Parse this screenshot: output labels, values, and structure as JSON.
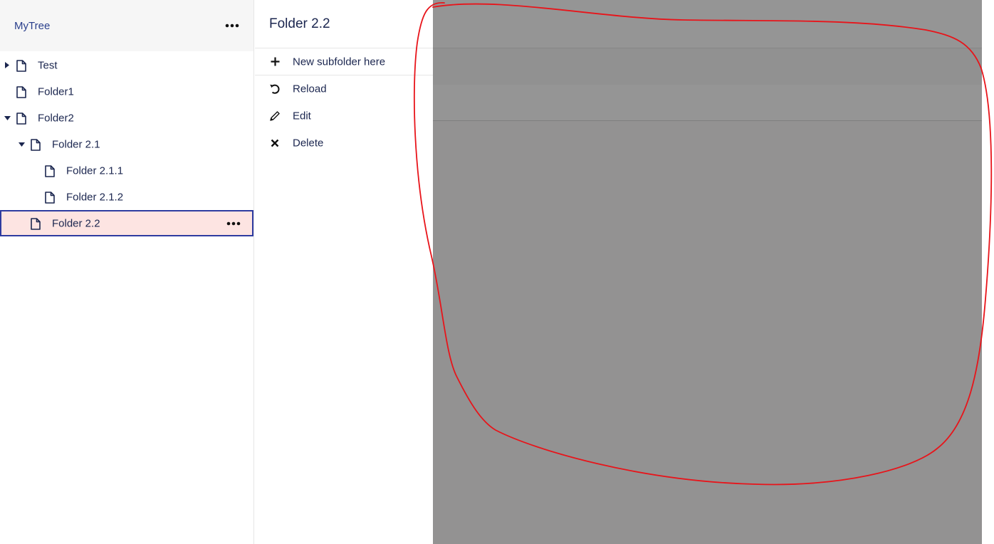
{
  "sidebar": {
    "title": "MyTree",
    "menu_icon": "more-horizontal-icon",
    "items": [
      {
        "label": "Test",
        "depth": 0,
        "caret": "right",
        "icon": "file-icon"
      },
      {
        "label": "Folder1",
        "depth": 0,
        "caret": "none",
        "icon": "file-icon"
      },
      {
        "label": "Folder2",
        "depth": 0,
        "caret": "down",
        "icon": "file-icon"
      },
      {
        "label": "Folder 2.1",
        "depth": 1,
        "caret": "down",
        "icon": "file-icon"
      },
      {
        "label": "Folder 2.1.1",
        "depth": 2,
        "caret": "none",
        "icon": "file-icon"
      },
      {
        "label": "Folder 2.1.2",
        "depth": 2,
        "caret": "none",
        "icon": "file-icon"
      },
      {
        "label": "Folder 2.2",
        "depth": 1,
        "caret": "none",
        "icon": "file-icon",
        "selected": true
      }
    ]
  },
  "panel": {
    "title": "Folder 2.2",
    "actions": [
      {
        "label": "New subfolder here",
        "icon": "plus-icon"
      },
      {
        "label": "Reload",
        "icon": "reload-icon"
      },
      {
        "label": "Edit",
        "icon": "pencil-icon"
      },
      {
        "label": "Delete",
        "icon": "close-icon"
      }
    ]
  },
  "colors": {
    "accent": "#2a3f8c",
    "selected_bg": "#fde4e2",
    "selected_border": "#2e3ba0",
    "overlay": "#959595",
    "annotation": "#e8141a"
  }
}
